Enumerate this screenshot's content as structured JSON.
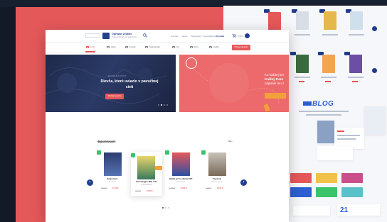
{
  "colors": {
    "brand_navy": "#233f8f",
    "accent_red": "#e5585a",
    "accent_orange": "#f2a13a",
    "sale_green": "#39c46a",
    "background": "#16202e"
  },
  "header": {
    "site_name": "Operator Zelibrio",
    "site_tagline": "Online portal of new agile books",
    "search_icon": "search-icon",
    "nav": [
      "Novinky",
      "Akcie",
      "Bestsellery",
      "Vydavateľstvá",
      "Kontakt"
    ],
    "active_nav": "Kontakt",
    "cart_count": "0,00 €",
    "avatar_icon": "user-icon"
  },
  "category_bar": {
    "items": [
      "Knihy",
      "Audio",
      "E-knihy",
      "Spoločenské",
      "Hry",
      "Filmy",
      "Hudba"
    ],
    "cta": "Všetky kategórie"
  },
  "hero_main": {
    "kicker": "RECENZIA KNIHY",
    "title": "Dievča, ktoré uviazlo v pavučinej sieti",
    "button": "Prečítaj recenziu"
  },
  "hero_secondary": {
    "line1": "Ku každej kni",
    "line2": "Knižný Kom",
    "line3": "zápisník len z"
  },
  "bestsellers": {
    "title": "Najpredávanejšie",
    "more": "Viac ›",
    "books": [
      {
        "title": "Krajcerkuze",
        "author": "Ján Bartoš",
        "old_price": "12,90 €",
        "price": "11,12 €"
      },
      {
        "title": "Peter Bugger: Milý zvah",
        "author": "Rudolf Sloboda",
        "old_price": "16,90 €",
        "price": "15,03 €"
      },
      {
        "title": "Tajinka rýč na zázriku DVD",
        "author": "Gabriel Gerá",
        "old_price": "14,90 €",
        "price": "12,91 €"
      },
      {
        "title": "Ohodenie",
        "author": "Mária Ďuríčková",
        "old_price": "17,90 €",
        "price": "15,51 €"
      }
    ]
  },
  "blog": {
    "logo": "BLOG"
  },
  "right_panel": {
    "stat_number": "21"
  }
}
